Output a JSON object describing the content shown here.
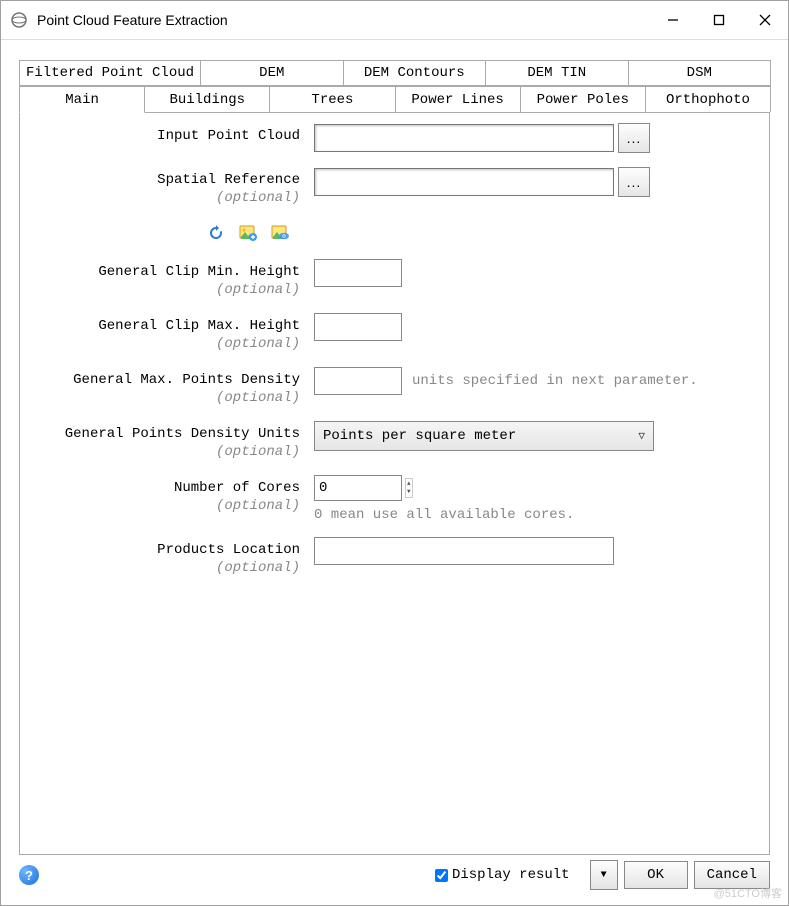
{
  "window": {
    "title": "Point Cloud Feature Extraction"
  },
  "tabs": {
    "top": [
      "Filtered Point Cloud",
      "DEM",
      "DEM Contours",
      "DEM TIN",
      "DSM"
    ],
    "bottom": [
      "Main",
      "Buildings",
      "Trees",
      "Power Lines",
      "Power Poles",
      "Orthophoto"
    ],
    "active": "Main"
  },
  "form": {
    "optional_label": "(optional)",
    "input_point_cloud": {
      "label": "Input Point Cloud",
      "value": ""
    },
    "spatial_reference": {
      "label": "Spatial Reference",
      "value": ""
    },
    "clip_min_height": {
      "label": "General Clip Min. Height",
      "value": ""
    },
    "clip_max_height": {
      "label": "General Clip Max. Height",
      "value": ""
    },
    "max_points_density": {
      "label": "General Max. Points Density",
      "value": "",
      "hint": "units specified in next parameter."
    },
    "points_density_units": {
      "label": "General Points Density Units",
      "value": "Points per square meter"
    },
    "number_of_cores": {
      "label": "Number of Cores",
      "value": "0",
      "hint": "0 mean use all available cores."
    },
    "products_location": {
      "label": "Products Location",
      "value": ""
    }
  },
  "footer": {
    "display_result": "Display result",
    "display_result_checked": true,
    "ok": "OK",
    "cancel": "Cancel"
  },
  "icons": {
    "browse": "..."
  },
  "watermark": "@51CTO博客"
}
